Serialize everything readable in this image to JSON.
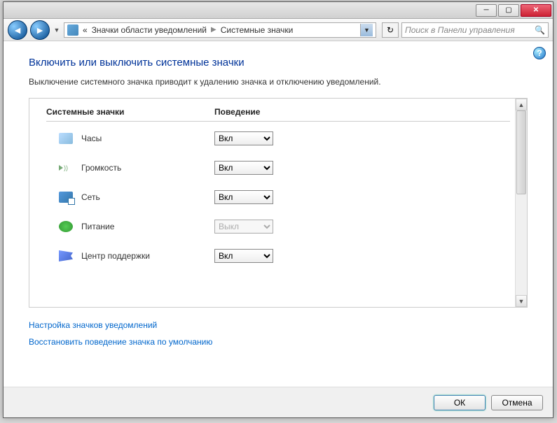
{
  "breadcrumb": {
    "prefix": "«",
    "part1": "Значки области уведомлений",
    "part2": "Системные значки"
  },
  "search": {
    "placeholder": "Поиск в Панели управления"
  },
  "heading": "Включить или выключить системные значки",
  "description": "Выключение системного значка приводит к удалению значка и отключению уведомлений.",
  "columns": {
    "c1": "Системные значки",
    "c2": "Поведение"
  },
  "options": {
    "on": "Вкл",
    "off": "Выкл"
  },
  "rows": [
    {
      "label": "Часы",
      "value": "Вкл",
      "enabled": true,
      "icon": "clock"
    },
    {
      "label": "Громкость",
      "value": "Вкл",
      "enabled": true,
      "icon": "volume"
    },
    {
      "label": "Сеть",
      "value": "Вкл",
      "enabled": true,
      "icon": "network"
    },
    {
      "label": "Питание",
      "value": "Выкл",
      "enabled": false,
      "icon": "power"
    },
    {
      "label": "Центр поддержки",
      "value": "Вкл",
      "enabled": true,
      "icon": "flag"
    }
  ],
  "links": {
    "l1": "Настройка значков уведомлений",
    "l2": "Восстановить поведение значка по умолчанию"
  },
  "buttons": {
    "ok": "ОК",
    "cancel": "Отмена"
  }
}
